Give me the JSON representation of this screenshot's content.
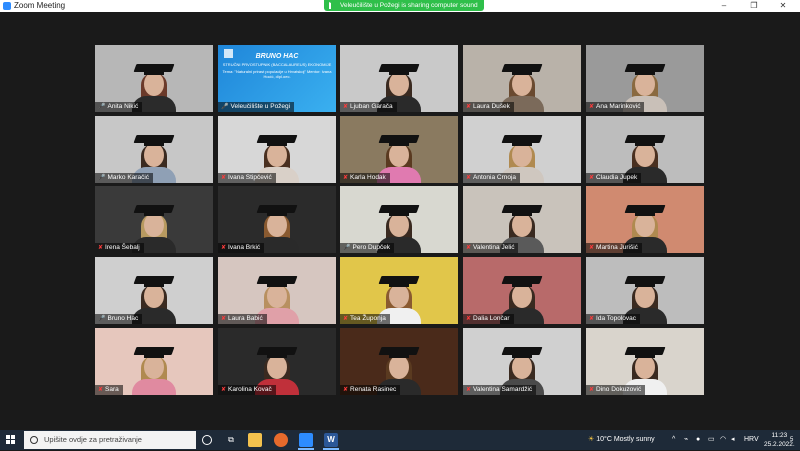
{
  "window": {
    "title": "Zoom Meeting",
    "controls": [
      "–",
      "❐",
      "✕"
    ]
  },
  "share_banner": "Veleučilište u Požegi is sharing computer sound",
  "slide": {
    "title": "BRUNO HAC",
    "subtitle": "STRUČNI PRVOSTUPNIK (BACCALAUREUS) EKONOMIJE",
    "detail": "Tema: \"Naturalni prirast populacije u Hrvatskoj\" Mentor: Ivana Hocić, dipl.oec."
  },
  "participants": [
    {
      "name": "Anita Nikić",
      "muted": false,
      "bg": "#b7b7b7",
      "body": "#2b2b2b",
      "hair": "#6b3a2a",
      "cap": true
    },
    {
      "name": "Veleučilište u Požegi",
      "muted": false,
      "slide": true
    },
    {
      "name": "Ljuban Garača",
      "muted": true,
      "bg": "#c9c9c9",
      "body": "#2a2a2a",
      "hair": "#3a2a20",
      "cap": true
    },
    {
      "name": "Laura Dušek",
      "muted": true,
      "bg": "#b9b2a9",
      "body": "#7b6a5a",
      "hair": "#6a4a30",
      "cap": true
    },
    {
      "name": "Ana Marinković",
      "muted": true,
      "bg": "#9a9a9a",
      "body": "#c9c0b8",
      "hair": "#8a6a40",
      "cap": true
    },
    {
      "name": "Marko Karačić",
      "muted": false,
      "bg": "#c7c7c7",
      "body": "#8fa0b5",
      "hair": "#3a2a20",
      "cap": true
    },
    {
      "name": "Ivana Stipčević",
      "muted": true,
      "bg": "#d7d7d7",
      "body": "#d9d0c8",
      "hair": "#4a3020",
      "cap": true
    },
    {
      "name": "Karla Hodak",
      "muted": true,
      "bg": "#8a7a60",
      "body": "#e07ab0",
      "hair": "#5a3a20",
      "cap": true
    },
    {
      "name": "Antonia Crnoja",
      "muted": true,
      "bg": "#d0d0d0",
      "body": "#cfc7bf",
      "hair": "#b08a50",
      "cap": true
    },
    {
      "name": "Claudia Jupek",
      "muted": true,
      "bg": "#bdbdbd",
      "body": "#2a2a2a",
      "hair": "#4a3020",
      "cap": true
    },
    {
      "name": "Irena Šebalj",
      "muted": true,
      "bg": "#3a3a3a",
      "body": "#2a2a2a",
      "hair": "#b89a60",
      "cap": true
    },
    {
      "name": "Ivana Brkić",
      "muted": true,
      "bg": "#2b2b2b",
      "body": "#2a2a2a",
      "hair": "#8a5a30",
      "cap": true
    },
    {
      "name": "Pero Dupček",
      "muted": false,
      "bg": "#d8d8d0",
      "body": "#2a2a2a",
      "hair": "#3a2a20",
      "cap": true
    },
    {
      "name": "Valentina Jelić",
      "muted": true,
      "bg": "#c9c3bb",
      "body": "#5a5a5a",
      "hair": "#3a2a20",
      "cap": true
    },
    {
      "name": "Martina Jurišić",
      "muted": true,
      "bg": "#d08a70",
      "body": "#2a2a2a",
      "hair": "#b08a50",
      "cap": true
    },
    {
      "name": "Bruno Hac",
      "muted": false,
      "bg": "#cfcfcf",
      "body": "#2a2a2a",
      "hair": "#3a2a20",
      "cap": true,
      "active": true
    },
    {
      "name": "Laura Babić",
      "muted": true,
      "bg": "#d6c6c0",
      "body": "#e0a0a8",
      "hair": "#b89060",
      "cap": true
    },
    {
      "name": "Tea Župonja",
      "muted": true,
      "bg": "#e1c64a",
      "body": "#f0f0f0",
      "hair": "#8a5a30",
      "cap": true
    },
    {
      "name": "Dalia Lončar",
      "muted": true,
      "bg": "#b86a6a",
      "body": "#2a2a2a",
      "hair": "#3a2a20",
      "cap": true
    },
    {
      "name": "Ida Topolovac",
      "muted": true,
      "bg": "#bdbdbd",
      "body": "#2a2a2a",
      "hair": "#3a2a20",
      "cap": true
    },
    {
      "name": "Sara",
      "muted": true,
      "bg": "#e6c7bd",
      "body": "#e08aa0",
      "hair": "#b08a50",
      "cap": true
    },
    {
      "name": "Karolina Kovač",
      "muted": true,
      "bg": "#2a2a2a",
      "body": "#c0303a",
      "hair": "#3a2a20",
      "cap": true
    },
    {
      "name": "Renata Rasinec",
      "muted": true,
      "bg": "#4a2a1a",
      "body": "#2a2a2a",
      "hair": "#5a3a20",
      "cap": true
    },
    {
      "name": "Valentina Samardžić",
      "muted": true,
      "bg": "#d0d0d0",
      "body": "#4a4a4a",
      "hair": "#3a2a20",
      "cap": true
    },
    {
      "name": "Dino Dokuzović",
      "muted": true,
      "bg": "#d9d4cc",
      "body": "#f0f0f0",
      "hair": "#3a2a20",
      "cap": true
    }
  ],
  "taskbar": {
    "search_placeholder": "Upišite ovdje za pretraživanje",
    "weather": "10°C  Mostly sunny",
    "language": "HRV",
    "time": "11:23",
    "date": "25.2.2022.",
    "notifications": "5"
  }
}
